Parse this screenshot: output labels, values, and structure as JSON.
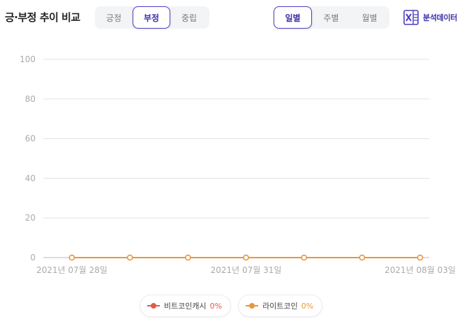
{
  "header": {
    "title": "긍·부정 추이 비교",
    "sentiment_tabs": [
      {
        "label": "긍정",
        "active": false
      },
      {
        "label": "부정",
        "active": true
      },
      {
        "label": "중립",
        "active": false
      }
    ],
    "period_tabs": [
      {
        "label": "일별",
        "active": true
      },
      {
        "label": "주별",
        "active": false
      },
      {
        "label": "월별",
        "active": false
      }
    ],
    "export_label": "분석데이터",
    "accent_color": "#4c3dbf"
  },
  "chart_data": {
    "type": "line",
    "x": [
      "2021년 07월 28일",
      "2021년 07월 29일",
      "2021년 07월 30일",
      "2021년 07월 31일",
      "2021년 08월 01일",
      "2021년 08월 02일",
      "2021년 08월 03일"
    ],
    "x_tick_labels": [
      "2021년 07월 28일",
      "2021년 07월 31일",
      "2021년 08월 03일"
    ],
    "y_ticks": [
      0,
      20,
      40,
      60,
      80,
      100
    ],
    "ylim": [
      0,
      100
    ],
    "grid": true,
    "series": [
      {
        "name": "비트코인캐시",
        "values": [
          0,
          0,
          0,
          0,
          0,
          0,
          0
        ],
        "color": "#e05b4a",
        "percent": "0%"
      },
      {
        "name": "라이트코인",
        "values": [
          0,
          0,
          0,
          0,
          0,
          0,
          0
        ],
        "color": "#e8973a",
        "percent": "0%"
      }
    ],
    "legend_position": "bottom"
  }
}
